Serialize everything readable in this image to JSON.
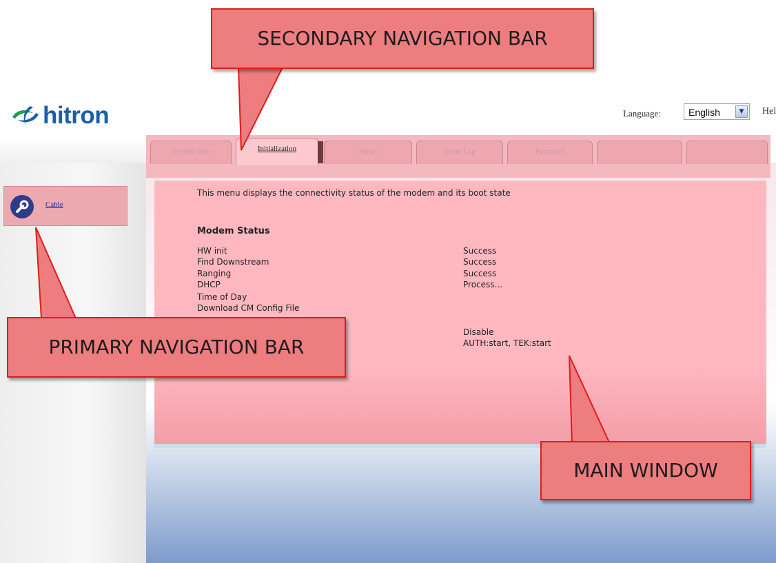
{
  "header": {
    "logo_text": "hitron",
    "language_label": "Language:",
    "language_value": "English",
    "help_label": "Hel"
  },
  "tabs": [
    {
      "label": "System Info",
      "active": false
    },
    {
      "label": "Initialization",
      "active": true
    },
    {
      "label": "Status",
      "active": false
    },
    {
      "label": "Event Log",
      "active": false
    },
    {
      "label": "Password",
      "active": false
    },
    {
      "label": "",
      "active": false
    },
    {
      "label": "",
      "active": false
    }
  ],
  "sidebar": {
    "items": [
      {
        "label": "Cable",
        "icon": "wrench-icon"
      }
    ]
  },
  "main": {
    "intro": "This menu displays the connectivity status of the modem and its boot state",
    "section_title": "Modem Status",
    "rows": [
      {
        "label": "HW init",
        "value": "Success"
      },
      {
        "label": "Find Downstream",
        "value": "Success"
      },
      {
        "label": "Ranging",
        "value": "Success"
      },
      {
        "label": "DHCP",
        "value": "Process..."
      },
      {
        "label": "Time of Day",
        "value": ""
      },
      {
        "label": "Download CM Config File",
        "value": ""
      }
    ],
    "extra_values": [
      "Disable",
      "AUTH:start, TEK:start"
    ]
  },
  "callouts": {
    "secondary": "SECONDARY NAVIGATION BAR",
    "primary": "PRIMARY NAVIGATION BAR",
    "main": "MAIN WINDOW"
  },
  "colors": {
    "callout_fill": "#ee7d80",
    "callout_border": "#e01b1b",
    "highlight_pink": "#ffb8c0",
    "logo_blue": "#1a5fa8"
  }
}
